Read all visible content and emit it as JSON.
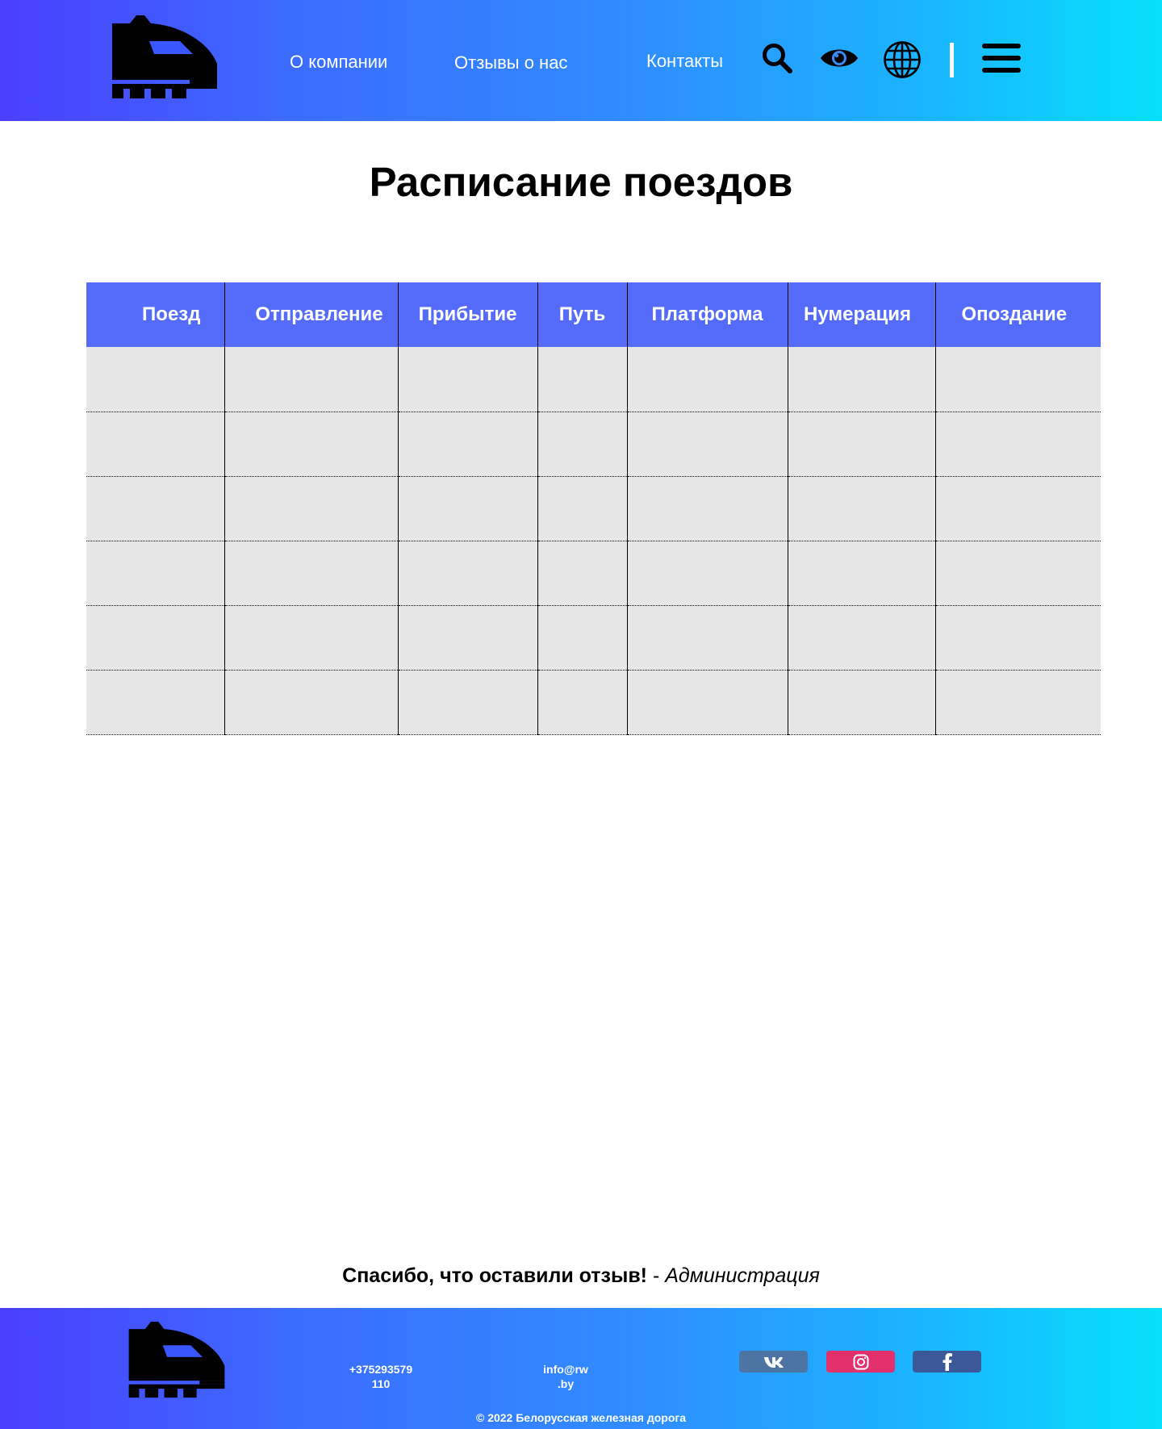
{
  "header": {
    "nav": {
      "about": "О компании",
      "reviews": "Отзывы о нас",
      "contacts": "Контакты"
    },
    "icons": [
      "train-logo-icon",
      "search-icon",
      "eye-icon",
      "globe-icon",
      "menu-icon"
    ]
  },
  "main": {
    "title": "Расписание поездов",
    "table": {
      "columns": [
        "Поезд",
        "Отправление",
        "Прибытие",
        "Путь",
        "Платформа",
        "Нумерация",
        "Опоздание"
      ],
      "rows": [
        [
          "",
          "",
          "",
          "",
          "",
          "",
          ""
        ],
        [
          "",
          "",
          "",
          "",
          "",
          "",
          ""
        ],
        [
          "",
          "",
          "",
          "",
          "",
          "",
          ""
        ],
        [
          "",
          "",
          "",
          "",
          "",
          "",
          ""
        ],
        [
          "",
          "",
          "",
          "",
          "",
          "",
          ""
        ],
        [
          "",
          "",
          "",
          "",
          "",
          "",
          ""
        ]
      ]
    }
  },
  "thanks": {
    "message": "Спасибо, что оставили отзыв!",
    "separator": " - ",
    "author": "Администрация"
  },
  "footer": {
    "phone_line1": "+375293579",
    "phone_line2": "110",
    "email_line1": "info@rw",
    "email_line2": ".by",
    "copyright": "© 2022 Белорусская железная дорога",
    "social": [
      "vk-icon",
      "instagram-icon",
      "facebook-icon"
    ]
  },
  "colors": {
    "gradient_start": "#4a3ffe",
    "gradient_end": "#07e0fc",
    "table_header": "#556cfb",
    "table_cell": "#e6e6e6",
    "vk": "#4c75a3",
    "instagram": "#e1306c",
    "facebook": "#3b5998"
  }
}
